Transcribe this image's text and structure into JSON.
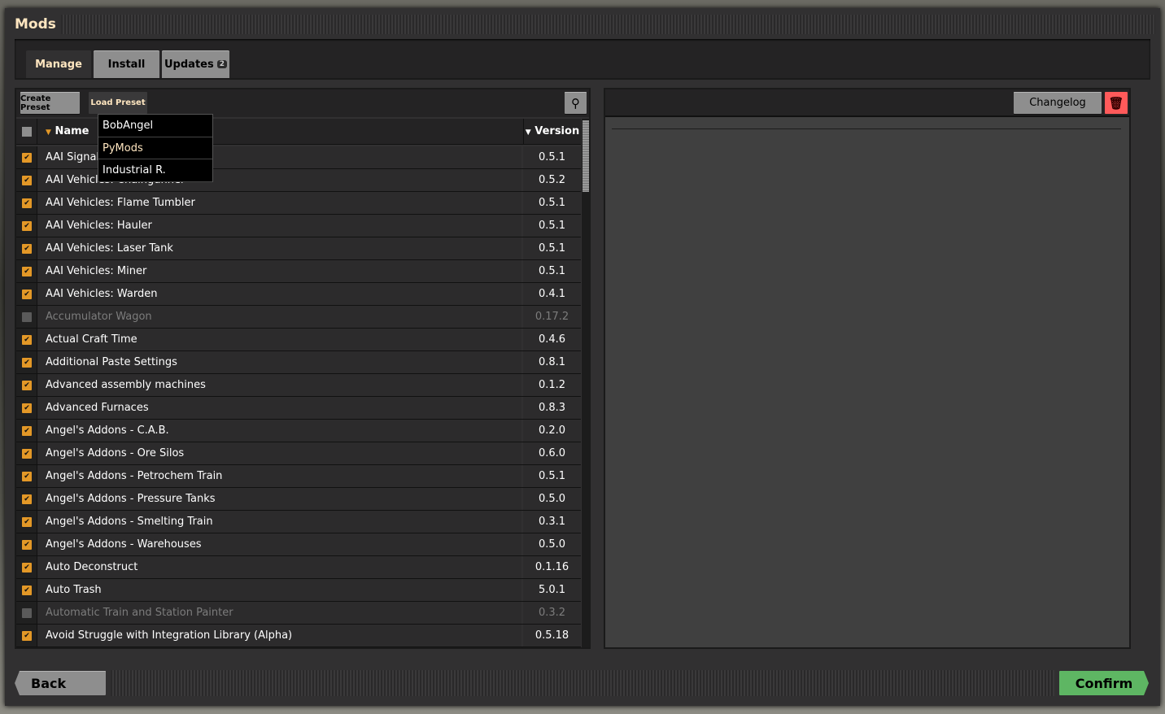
{
  "window": {
    "title": "Mods"
  },
  "tabs": [
    {
      "label": "Manage",
      "selected": true
    },
    {
      "label": "Install"
    },
    {
      "label": "Updates",
      "badge": "2"
    }
  ],
  "toolbar": {
    "create_preset": "Create Preset",
    "load_preset": "Load Preset",
    "search_icon": "search-icon"
  },
  "preset_menu": [
    {
      "label": "BobAngel"
    },
    {
      "label": "PyMods",
      "highlighted": true
    },
    {
      "label": "Industrial R."
    }
  ],
  "table": {
    "headers": {
      "name": "Name",
      "version": "Version"
    },
    "rows": [
      {
        "name": "AAI Signal Transmission",
        "version": "0.5.1",
        "enabled": true
      },
      {
        "name": "AAI Vehicles: Chaingunner",
        "version": "0.5.2",
        "enabled": true
      },
      {
        "name": "AAI Vehicles: Flame Tumbler",
        "version": "0.5.1",
        "enabled": true
      },
      {
        "name": "AAI Vehicles: Hauler",
        "version": "0.5.1",
        "enabled": true
      },
      {
        "name": "AAI Vehicles: Laser Tank",
        "version": "0.5.1",
        "enabled": true
      },
      {
        "name": "AAI Vehicles: Miner",
        "version": "0.5.1",
        "enabled": true
      },
      {
        "name": "AAI Vehicles: Warden",
        "version": "0.4.1",
        "enabled": true
      },
      {
        "name": "Accumulator Wagon",
        "version": "0.17.2",
        "enabled": false
      },
      {
        "name": "Actual Craft Time",
        "version": "0.4.6",
        "enabled": true
      },
      {
        "name": "Additional Paste Settings",
        "version": "0.8.1",
        "enabled": true
      },
      {
        "name": "Advanced assembly machines",
        "version": "0.1.2",
        "enabled": true
      },
      {
        "name": "Advanced Furnaces",
        "version": "0.8.3",
        "enabled": true
      },
      {
        "name": "Angel's Addons - C.A.B.",
        "version": "0.2.0",
        "enabled": true
      },
      {
        "name": "Angel's Addons - Ore Silos",
        "version": "0.6.0",
        "enabled": true
      },
      {
        "name": "Angel's Addons - Petrochem Train",
        "version": "0.5.1",
        "enabled": true
      },
      {
        "name": "Angel's Addons - Pressure Tanks",
        "version": "0.5.0",
        "enabled": true
      },
      {
        "name": "Angel's Addons - Smelting Train",
        "version": "0.3.1",
        "enabled": true
      },
      {
        "name": "Angel's Addons - Warehouses",
        "version": "0.5.0",
        "enabled": true
      },
      {
        "name": "Auto Deconstruct",
        "version": "0.1.16",
        "enabled": true
      },
      {
        "name": "Auto Trash",
        "version": "5.0.1",
        "enabled": true
      },
      {
        "name": "Automatic Train and Station Painter",
        "version": "0.3.2",
        "enabled": false
      },
      {
        "name": "Avoid Struggle with Integration Library (Alpha)",
        "version": "0.5.18",
        "enabled": true
      }
    ]
  },
  "details": {
    "changelog": "Changelog",
    "delete_icon": "trash-icon"
  },
  "footer": {
    "back": "Back",
    "confirm": "Confirm"
  },
  "colors": {
    "accent": "#ffe6c0",
    "checkbox": "#e39827",
    "confirm": "#5eb663",
    "delete": "#ff5a5a"
  }
}
